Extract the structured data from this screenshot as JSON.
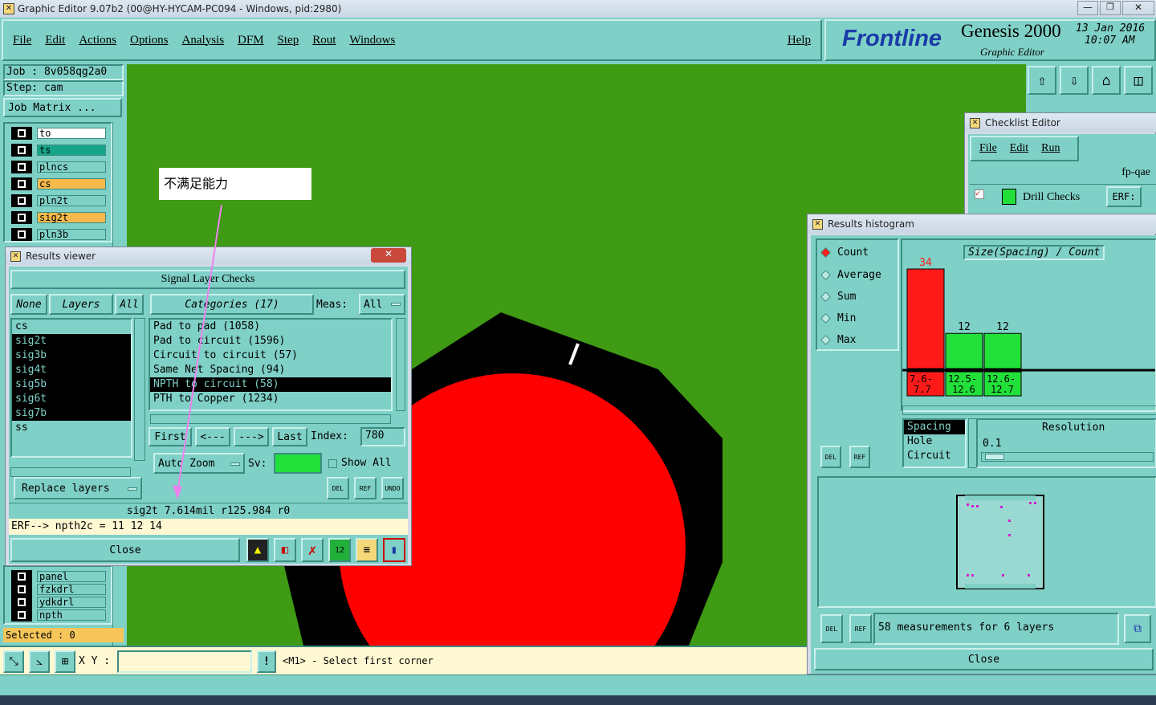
{
  "titlebar": {
    "title": "Graphic Editor 9.07b2 (00@HY-HYCAM-PC094 - Windows, pid:2980)"
  },
  "menu": {
    "items": [
      "File",
      "Edit",
      "Actions",
      "Options",
      "Analysis",
      "DFM",
      "Step",
      "Rout",
      "Windows"
    ],
    "help": "Help"
  },
  "brand": {
    "logo": "Frontline",
    "product": "Genesis 2000",
    "subtitle": "Graphic Editor",
    "date": "13 Jan 2016",
    "time": "10:07 AM"
  },
  "job": {
    "job": "Job  : 8v058qg2a0",
    "step": "Step: cam",
    "matrix_button": "Job Matrix ..."
  },
  "layers_top": [
    {
      "name": "to",
      "color": "#ffffff"
    },
    {
      "name": "ts",
      "color": "#17a589"
    },
    {
      "name": "plncs",
      "color": "#7fd0c6"
    },
    {
      "name": "cs",
      "color": "#f6b94b"
    },
    {
      "name": "pln2t",
      "color": "#7fd0c6"
    },
    {
      "name": "sig2t",
      "color": "#f6b94b"
    },
    {
      "name": "pln3b",
      "color": "#7fd0c6"
    }
  ],
  "layers_bottom": [
    "panel",
    "fzkdrl",
    "ydkdrl",
    "npth"
  ],
  "selected": "Selected : 0",
  "annotation": {
    "text": "不满足能力"
  },
  "results_viewer": {
    "title": "Results viewer",
    "header": "Signal Layer Checks",
    "none": "None",
    "layers": "Layers",
    "all": "All",
    "categories": "Categories (17)",
    "meas_label": "Meas:",
    "meas_value": "All",
    "layer_list": [
      "cs",
      "sig2t",
      "sig3b",
      "sig4t",
      "sig5b",
      "sig6t",
      "sig7b",
      "ss"
    ],
    "category_list": [
      "Pad to pad (1058)",
      "Pad to circuit (1596)",
      "Circuit to circuit (57)",
      "Same Net Spacing (94)",
      "NPTH to circuit (58)",
      "PTH to Copper (1234)"
    ],
    "nav": {
      "first": "First",
      "prev": "<---",
      "next": "--->",
      "last": "Last",
      "index_label": "Index:",
      "index_value": "780"
    },
    "autozoom": "Auto Zoom",
    "sv": "Sv:",
    "show_all": "Show All",
    "replace_layers": "Replace layers",
    "del": "DEL",
    "ref": "REF",
    "undo": "UNDO",
    "status": "sig2t 7.614mil  r125.984  r0",
    "erf": "ERF--> npth2c = 11 12 14",
    "close": "Close"
  },
  "checklist": {
    "title": "Checklist Editor",
    "menu": [
      "File",
      "Edit",
      "Run"
    ],
    "name": "fp-qae",
    "check": "Drill Checks",
    "erf": "ERF:"
  },
  "histogram": {
    "title": "Results histogram",
    "options": [
      "Count",
      "Average",
      "Sum",
      "Min",
      "Max"
    ],
    "selected_option": "Count",
    "chart_title": "Size(Spacing) / Count",
    "by_list": [
      "Spacing",
      "Hole",
      "Circuit"
    ],
    "resolution_label": "Resolution",
    "resolution_value": "0.1",
    "summary": "58 measurements for 6 layers",
    "close": "Close"
  },
  "chart_data": {
    "type": "bar",
    "title": "Size(Spacing) / Count",
    "categories": [
      "7.6-7.7",
      "12.5-12.6",
      "12.6-12.7"
    ],
    "values": [
      34,
      12,
      12
    ],
    "colors": [
      "#ff1a1a",
      "#22e03a",
      "#22e03a"
    ]
  },
  "bottombar": {
    "xy_label": "X Y :",
    "xy_value": "",
    "prompt": "<M1> - Select first corner"
  },
  "colors": {
    "canvas": "#3f9a14",
    "pad": "#ff0000",
    "panel": "#7fd0c6"
  }
}
